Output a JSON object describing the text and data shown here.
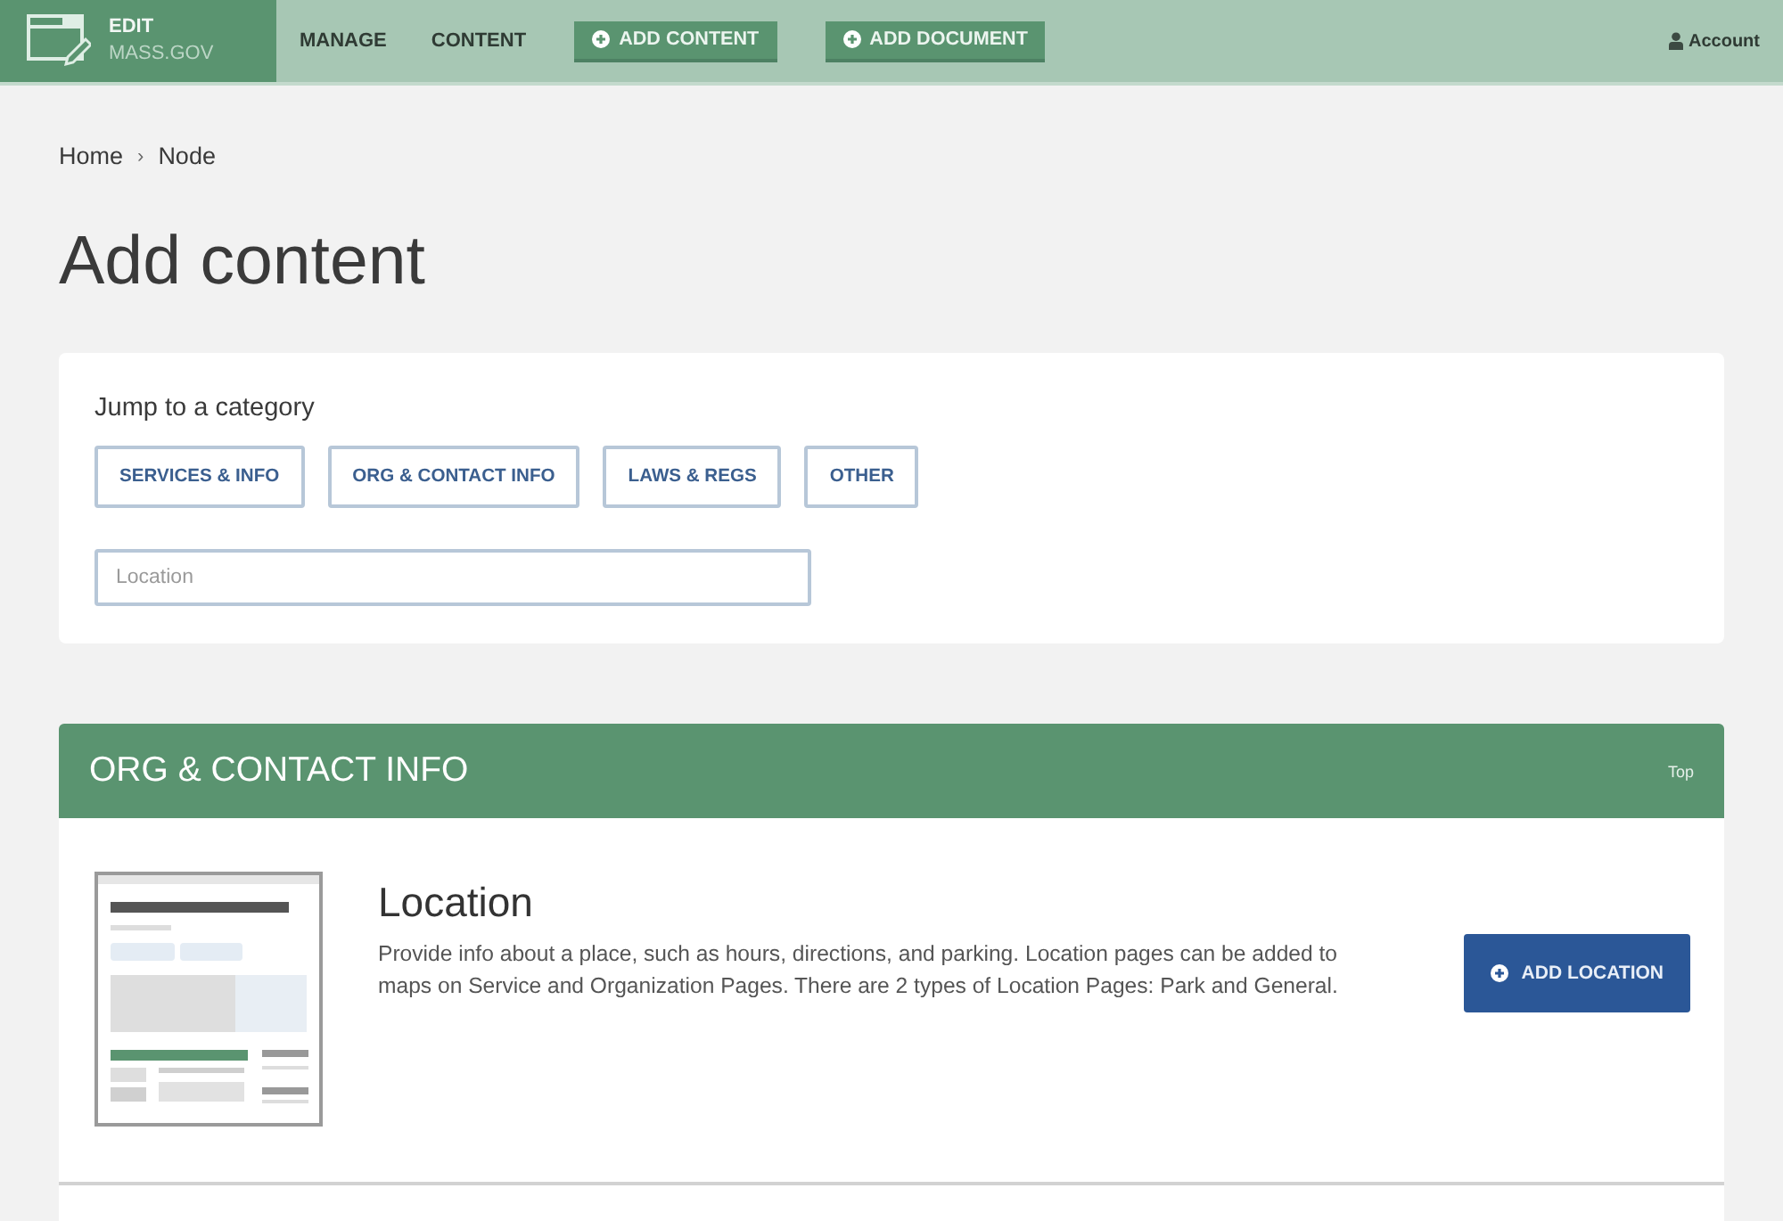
{
  "header": {
    "logo": {
      "line_1": "EDIT",
      "line_2": "MASS.GOV"
    },
    "nav": [
      {
        "label": "MANAGE",
        "kind": "link"
      },
      {
        "label": "CONTENT",
        "kind": "link"
      },
      {
        "label": "ADD CONTENT",
        "kind": "button"
      },
      {
        "label": "ADD DOCUMENT",
        "kind": "button"
      }
    ],
    "account": "Account"
  },
  "breadcrumb": {
    "items": [
      "Home",
      "Node"
    ],
    "separator": "›"
  },
  "title": "Add content",
  "jump": {
    "label": "Jump to a category",
    "categories": [
      "SERVICES & INFO",
      "ORG & CONTACT INFO",
      "LAWS & REGS",
      "OTHER"
    ],
    "filter": {
      "placeholder": "Location"
    }
  },
  "sections": [
    {
      "title": "ORG & CONTACT INFO",
      "top_link": "Top",
      "items": [
        {
          "title": "Location",
          "description": "Provide info about a place, such as hours, directions, and parking. Location pages can be added to maps on Service and Organization Pages. There are 2 types of Location Pages: Park and General.",
          "button": "ADD LOCATION"
        }
      ]
    }
  ]
}
